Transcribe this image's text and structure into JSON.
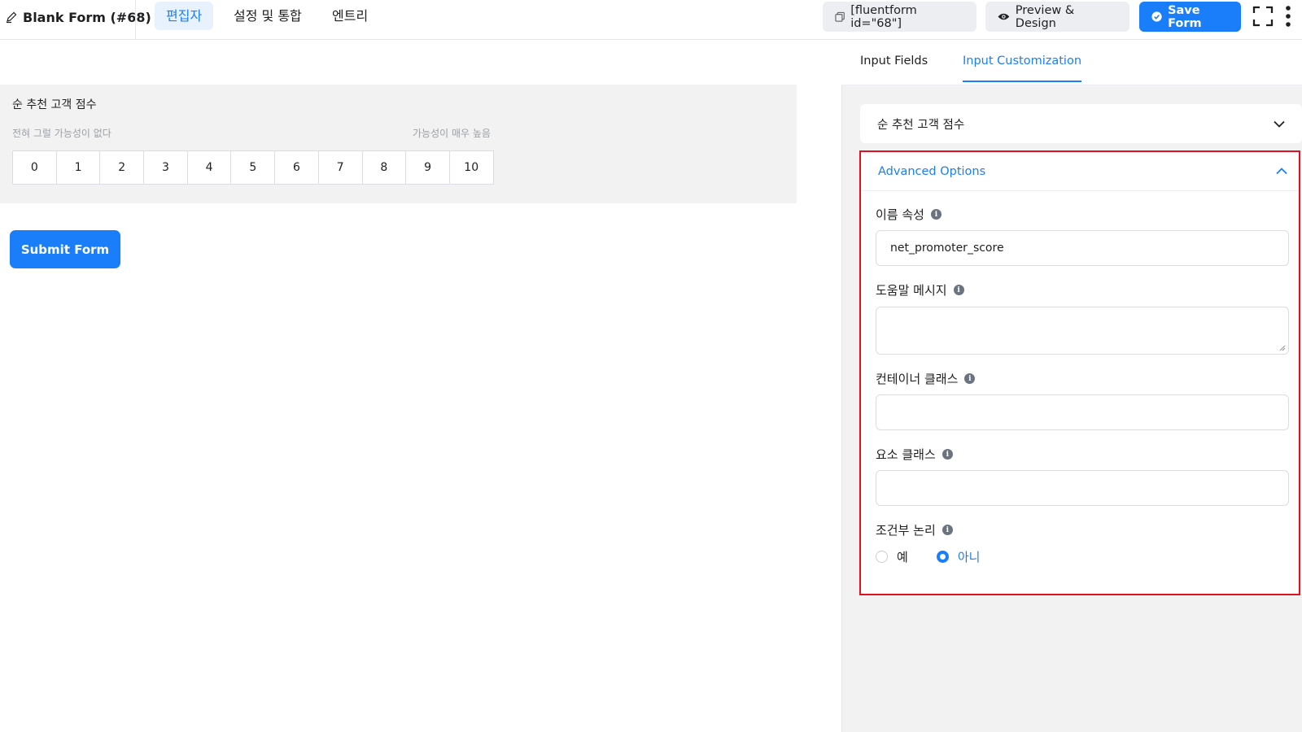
{
  "header": {
    "form_title": "Blank Form (#68)",
    "tabs": [
      {
        "label": "편집자",
        "active": true
      },
      {
        "label": "설정 및 통합",
        "active": false
      },
      {
        "label": "엔트리",
        "active": false
      }
    ],
    "shortcode_label": "[fluentform id=\"68\"]",
    "preview_label": "Preview & Design",
    "save_label": "Save Form"
  },
  "editor": {
    "nps_label": "순 추천 고객 점수",
    "nps_min_label": "전혀 그럴 가능성이 없다",
    "nps_max_label": "가능성이 매우 높음",
    "nps_scale": [
      "0",
      "1",
      "2",
      "3",
      "4",
      "5",
      "6",
      "7",
      "8",
      "9",
      "10"
    ],
    "submit_label": "Submit Form"
  },
  "sidebar": {
    "tabs": [
      {
        "label": "Input Fields",
        "active": false
      },
      {
        "label": "Input Customization",
        "active": true
      }
    ],
    "field_name": "순 추천 고객 점수",
    "advanced": {
      "title": "Advanced Options",
      "name_attr_label": "이름 속성",
      "name_attr_value": "net_promoter_score",
      "help_message_label": "도움말 메시지",
      "help_message_value": "",
      "container_class_label": "컨테이너 클래스",
      "container_class_value": "",
      "element_class_label": "요소 클래스",
      "element_class_value": "",
      "conditional_logic_label": "조건부 논리",
      "conditional_options": [
        {
          "label": "예",
          "selected": false
        },
        {
          "label": "아니",
          "selected": true
        }
      ]
    }
  },
  "colors": {
    "accent": "#1a7efb",
    "highlight_border": "#e0101e",
    "panel_bg": "#f2f2f2"
  }
}
